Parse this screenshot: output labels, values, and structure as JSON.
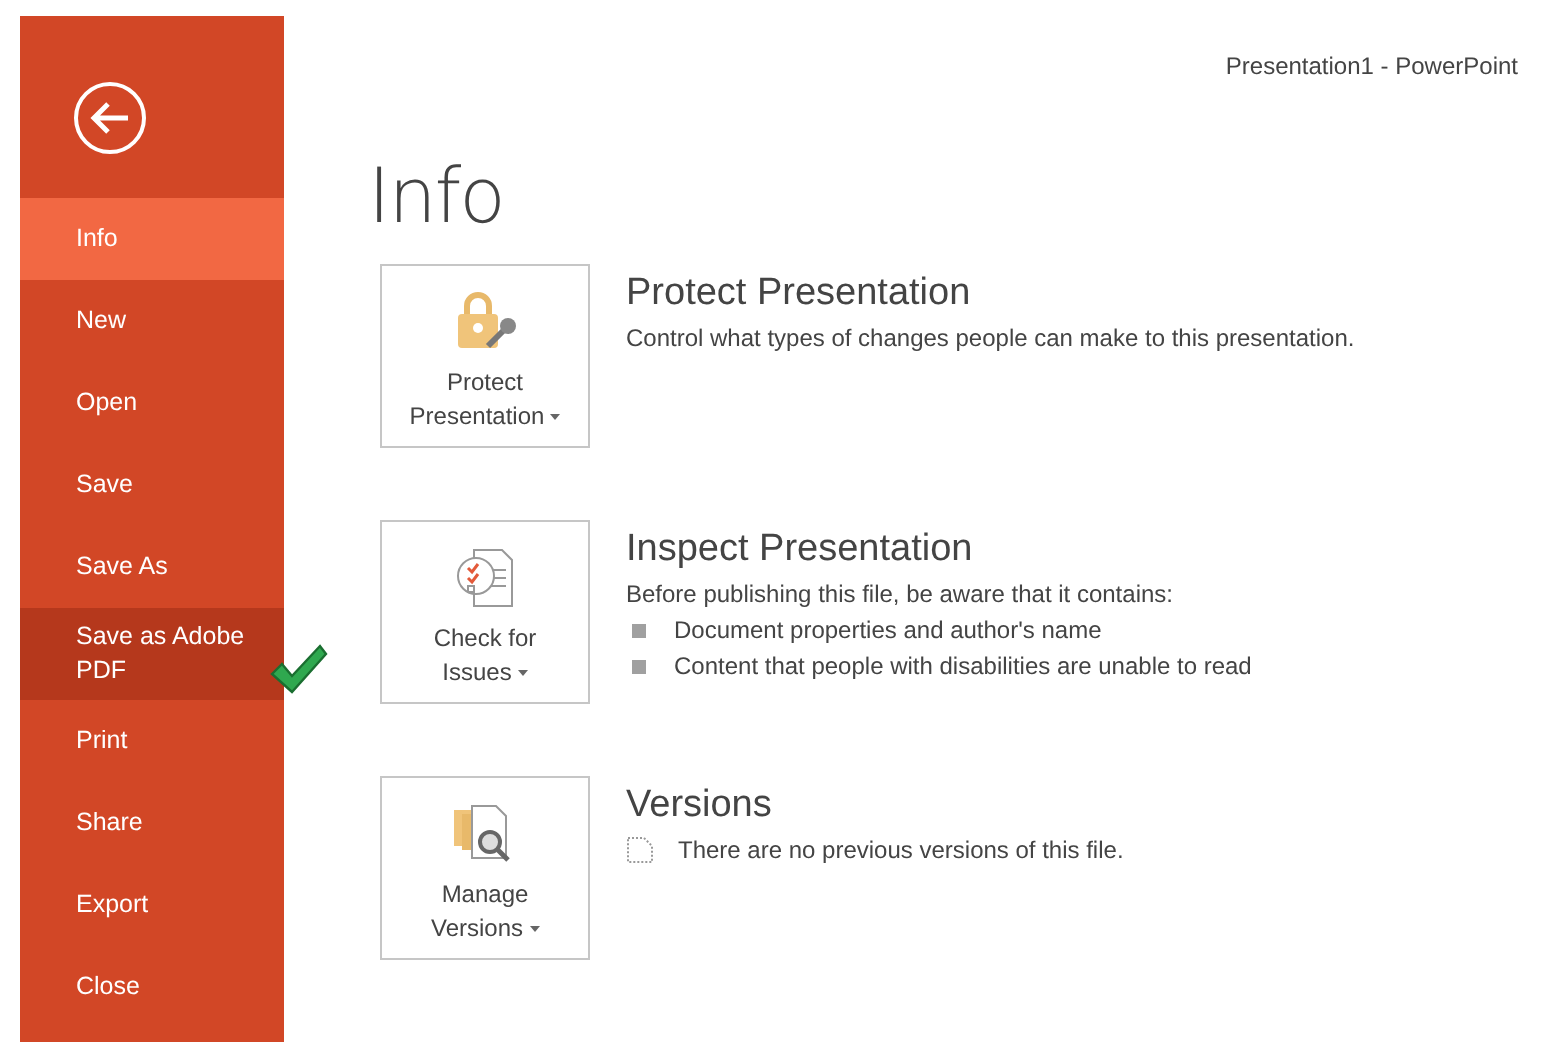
{
  "window": {
    "title": "Presentation1 - PowerPoint"
  },
  "sidebar": {
    "items": [
      {
        "label": "Info",
        "selected": true,
        "hovered": false
      },
      {
        "label": "New",
        "selected": false,
        "hovered": false
      },
      {
        "label": "Open",
        "selected": false,
        "hovered": false
      },
      {
        "label": "Save",
        "selected": false,
        "hovered": false
      },
      {
        "label": "Save As",
        "selected": false,
        "hovered": false
      },
      {
        "label": "Save as Adobe PDF",
        "selected": false,
        "hovered": true
      },
      {
        "label": "Print",
        "selected": false,
        "hovered": false
      },
      {
        "label": "Share",
        "selected": false,
        "hovered": false
      },
      {
        "label": "Export",
        "selected": false,
        "hovered": false
      },
      {
        "label": "Close",
        "selected": false,
        "hovered": false
      }
    ]
  },
  "heading": "Info",
  "sections": [
    {
      "kind": "protect",
      "button": [
        "Protect",
        "Presentation"
      ],
      "title": "Protect Presentation",
      "description": "Control what types of changes people can make to this presentation."
    },
    {
      "kind": "inspect",
      "button": [
        "Check for",
        "Issues"
      ],
      "title": "Inspect Presentation",
      "description": "Before publishing this file, be aware that it contains:",
      "bullets": [
        "Document properties and author's name",
        "Content that people with disabilities are unable to read"
      ]
    },
    {
      "kind": "versions",
      "button": [
        "Manage",
        "Versions"
      ],
      "title": "Versions",
      "note": "There are no previous versions of this file."
    }
  ]
}
